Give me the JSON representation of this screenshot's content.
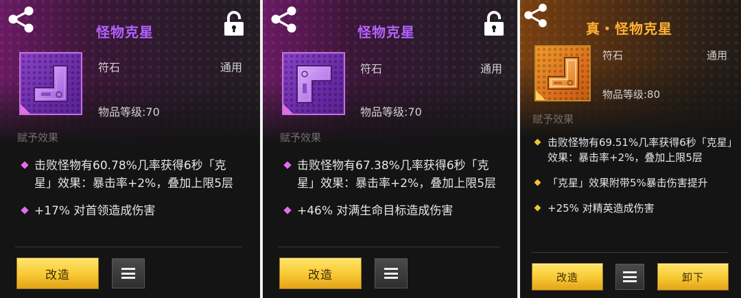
{
  "panels": [
    {
      "title": "怪物克星",
      "type_label": "符石",
      "usage": "通用",
      "level_text": "物品等级:70",
      "section_label": "赋予效果",
      "effects": [
        "击败怪物有60.78%几率获得6秒「克星」效果：暴击率+2%，叠加上限5层",
        "+17% 对首领造成伤害"
      ],
      "modify_label": "改造",
      "rarity_color": "#b461ff",
      "icon": "rune-purple-icon"
    },
    {
      "title": "怪物克星",
      "type_label": "符石",
      "usage": "通用",
      "level_text": "物品等级:70",
      "section_label": "赋予效果",
      "effects": [
        "击败怪物有67.38%几率获得6秒「克星」效果：暴击率+2%，叠加上限5层",
        "+46% 对满生命目标造成伤害"
      ],
      "modify_label": "改造",
      "rarity_color": "#b461ff",
      "icon": "rune-purple-icon"
    },
    {
      "title": "真・怪物克星",
      "type_label": "符石",
      "usage": "通用",
      "level_text": "物品等级:80",
      "section_label": "赋予效果",
      "effects": [
        "击败怪物有69.51%几率获得6秒「克星」效果：暴击率+2%，叠加上限5层",
        "「克星」效果附带5%暴击伤害提升",
        "+25% 对精英造成伤害"
      ],
      "modify_label": "改造",
      "unequip_label": "卸下",
      "rarity_color": "#ffb132",
      "icon": "rune-orange-icon"
    }
  ]
}
